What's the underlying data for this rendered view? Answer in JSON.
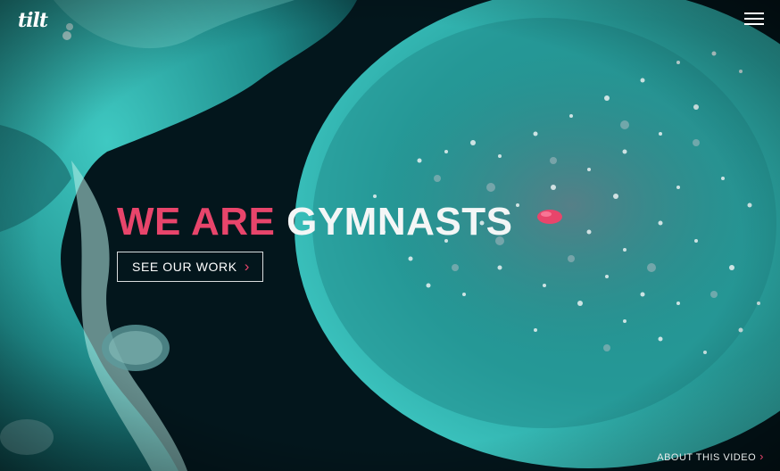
{
  "header": {
    "logo_text": "tilt",
    "menu_icon": "hamburger-menu-icon"
  },
  "hero": {
    "headline_accent": "WE ARE",
    "headline_main": "GYMNASTS",
    "cta_label": "SEE OUR WORK",
    "cta_arrow": "›",
    "background_description_icon": "abstract-glitter-background"
  },
  "footer": {
    "about_label": "ABOUT THIS VIDEO",
    "about_arrow": "›"
  },
  "colors": {
    "accent": "#e8456b",
    "teal": "#2fb3b0",
    "dark": "#04141a",
    "text": "#ffffff"
  }
}
